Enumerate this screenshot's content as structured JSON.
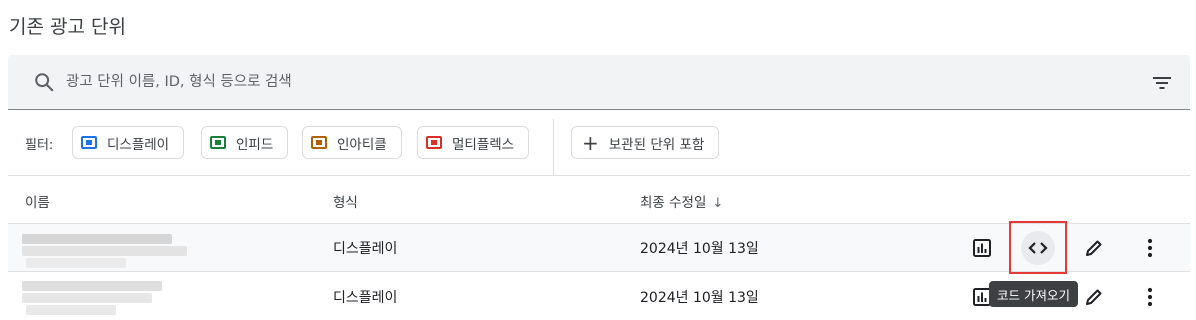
{
  "section": {
    "title": "기존 광고 단위"
  },
  "search": {
    "placeholder": "광고 단위 이름, ID, 형식 등으로 검색"
  },
  "filters": {
    "label": "필터:",
    "chips": [
      {
        "label": "디스플레이",
        "color": "#1a73e8"
      },
      {
        "label": "인피드",
        "color": "#188038"
      },
      {
        "label": "인아티클",
        "color": "#b06000"
      },
      {
        "label": "멀티플렉스",
        "color": "#d93025"
      }
    ],
    "archived_label": "보관된 단위 포함"
  },
  "table": {
    "columns": {
      "name": "이름",
      "format": "형식",
      "last_modified": "최종 수정일"
    },
    "rows": [
      {
        "format": "디스플레이",
        "last_modified": "2024년 10월 13일"
      },
      {
        "format": "디스플레이",
        "last_modified": "2024년 10월 13일"
      }
    ]
  },
  "tooltip": {
    "text": "코드 가져오기"
  }
}
